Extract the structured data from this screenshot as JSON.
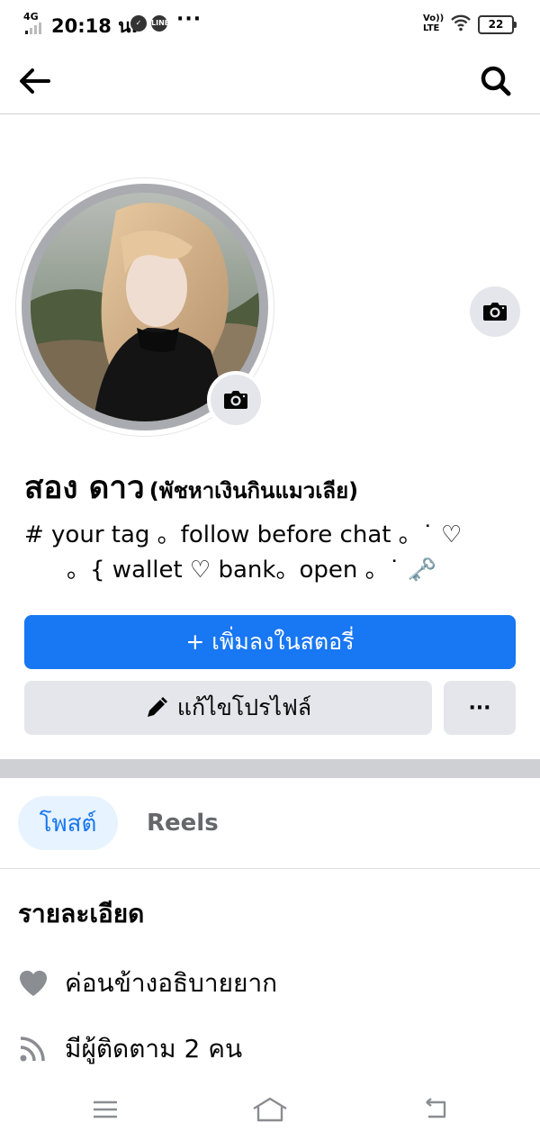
{
  "status_bar": {
    "network": "4G",
    "time": "20:18 น.",
    "notif_icons": [
      "check-circle-icon",
      "line-app-icon"
    ],
    "more": "···",
    "volte": "Vo))\nLTE",
    "battery": "22"
  },
  "header": {
    "back_icon": "arrow-left-icon",
    "search_icon": "search-icon"
  },
  "profile": {
    "name": "สอง ดาว",
    "alternate_name": "(พัชหาเงินกินแมวเลีย)",
    "bio_line1": "# your tag 。follow before chat  。˙ ♡",
    "bio_line2": "。{ wallet ♡ bank。open  。˙ 🗝️"
  },
  "buttons": {
    "add_story": "+ เพิ่มลงในสตอรี่",
    "edit_profile": "แก้ไขโปรไฟล์",
    "more": "···"
  },
  "tabs": [
    {
      "label": "โพสต์",
      "active": true
    },
    {
      "label": "Reels",
      "active": false
    }
  ],
  "details": {
    "title": "รายละเอียด",
    "items": [
      {
        "icon": "heart-icon",
        "text": "ค่อนข้างอธิบายยาก"
      },
      {
        "icon": "rss-feed-icon",
        "text": "มีผู้ติดตาม 2 คน"
      }
    ]
  },
  "colors": {
    "accent": "#1877f2",
    "button_gray": "#e4e6eb",
    "tab_active_bg": "#e7f3ff",
    "divider": "#ced0d4"
  }
}
